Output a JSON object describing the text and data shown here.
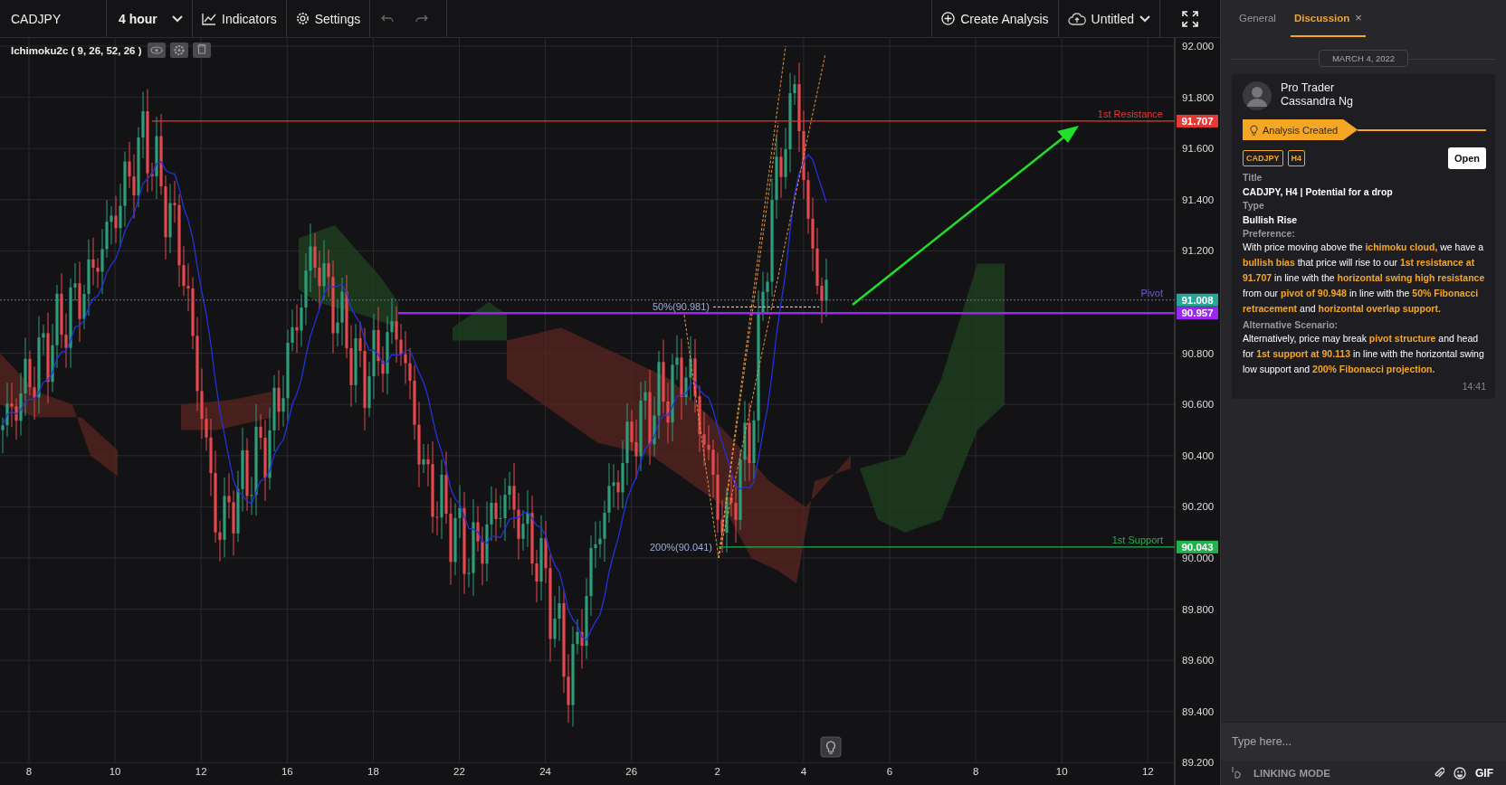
{
  "toolbar": {
    "symbol": "CADJPY",
    "interval": "4 hour",
    "indicators": "Indicators",
    "settings": "Settings",
    "create_analysis": "Create Analysis",
    "layout_name": "Untitled"
  },
  "chart": {
    "indicator_label": "Ichimoku2c ( 9, 26, 52, 26 )",
    "price_ticks": [
      "92.000",
      "91.800",
      "91.600",
      "91.400",
      "91.200",
      "90.800",
      "90.600",
      "90.400",
      "90.200",
      "90.000",
      "89.800",
      "89.600",
      "89.400",
      "89.200"
    ],
    "time_ticks": [
      "8",
      "10",
      "12",
      "16",
      "18",
      "22",
      "24",
      "26",
      "2",
      "4",
      "6",
      "8",
      "10",
      "12"
    ],
    "levels": [
      {
        "kind": "resistance",
        "label": "1st Resistance",
        "price_tag": "91.707",
        "color": "#e53935"
      },
      {
        "kind": "last",
        "label": "Pivot",
        "price_tag": "91.008",
        "color": "#26a69a"
      },
      {
        "kind": "pivot",
        "price_tag": "90.957",
        "color": "#9c27f5"
      },
      {
        "kind": "support",
        "label": "1st Support",
        "price_tag": "90.043",
        "color": "#22b14c"
      }
    ],
    "fib_labels": [
      {
        "kind": "retracement",
        "text": "50%(90.981)"
      },
      {
        "kind": "projection",
        "text": "200%(90.041)"
      }
    ]
  },
  "panel": {
    "tabs": [
      {
        "label": "General",
        "selected": false
      },
      {
        "label": "Discussion",
        "selected": true,
        "close": "×"
      }
    ],
    "date": "MARCH 4, 2022",
    "post": {
      "role": "Pro Trader",
      "author": "Cassandra Ng",
      "event": "Analysis Created",
      "tags": [
        "CADJPY",
        "H4"
      ],
      "open_button": "Open",
      "fields": [
        {
          "label": "Title",
          "value": "CADJPY, H4 | Potential for a drop"
        },
        {
          "label": "Type",
          "value": "Bullish Rise"
        }
      ],
      "sections": [
        {
          "label": "Preference:",
          "text": "With price moving above the **ichimoku cloud,** we have a **bullish bias** that price will rise to our **1st resistance at 91.707** in line with the **horizontal swing high resistance** from our **pivot of 90.948** in line with the **50% Fibonacci retracement** and **horizontal overlap support.**"
        },
        {
          "label": "Alternative Scenario:",
          "text": "Alternatively, price may break **pivot structure** and head for **1st support at 90.113** in line with the horizontal swing low support and **200% Fibonacci projection.**"
        }
      ],
      "time": "14:41"
    },
    "composer": {
      "placeholder": "Type here..."
    },
    "footer": {
      "linking_mode": "LINKING MODE",
      "gif": "GIF"
    }
  }
}
